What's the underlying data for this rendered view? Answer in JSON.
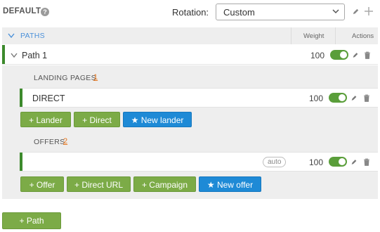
{
  "header": {
    "title": "DEFAULT",
    "help_icon": "question-circle-icon",
    "rotation_label": "Rotation:",
    "rotation_value": "Custom",
    "edit_icon": "pencil-icon",
    "add_icon": "plus-icon"
  },
  "paths_table": {
    "section_label": "PATHS",
    "weight_header": "Weight",
    "actions_header": "Actions"
  },
  "path": {
    "name": "Path 1",
    "weight": "100",
    "enabled": true
  },
  "landing_pages": {
    "label": "LANDING PAGES",
    "count": "1",
    "items": [
      {
        "name": "DIRECT",
        "weight": "100",
        "enabled": true
      }
    ],
    "buttons": {
      "add_lander": "+ Lander",
      "add_direct": "+ Direct",
      "new_lander": "New lander"
    }
  },
  "offers": {
    "label": "OFFERS",
    "count": "2",
    "items": [
      {
        "name": "",
        "auto_label": "auto",
        "weight": "100",
        "enabled": true
      }
    ],
    "buttons": {
      "add_offer": "+ Offer",
      "add_direct_url": "+ Direct URL",
      "add_campaign": "+ Campaign",
      "new_offer": "New offer"
    }
  },
  "footer": {
    "add_path": "+ Path"
  },
  "colors": {
    "accent_green": "#7cab47",
    "accent_blue": "#1e8ad6",
    "path_bar": "#3c8a2c",
    "count_orange": "#e8761c",
    "section_link": "#4a90d9"
  }
}
